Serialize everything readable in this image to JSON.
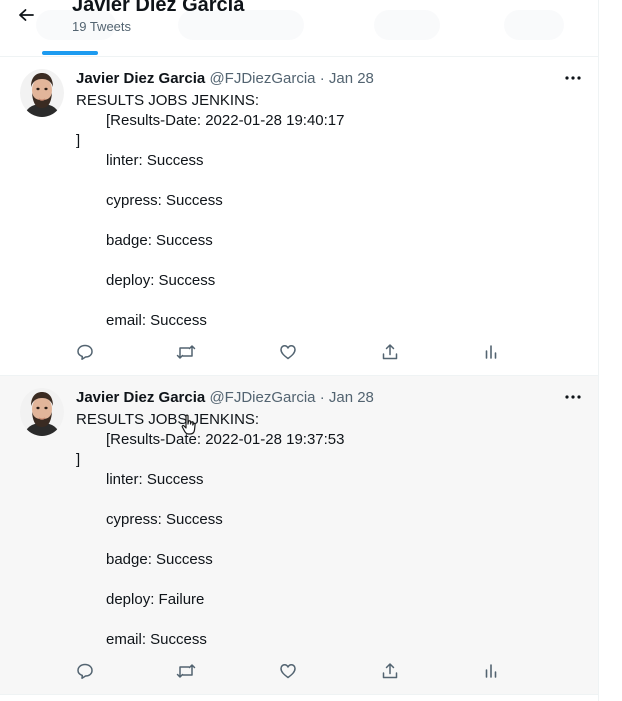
{
  "header": {
    "profile_name": "Javier Diez Garcia",
    "tweet_count": "19 Tweets"
  },
  "colors": {
    "accent": "#1d9bf0",
    "secondary_text": "#536471",
    "icon_gray": "#536471"
  },
  "icons": {
    "back": "arrow-left-icon",
    "more": "more-dots-icon",
    "reply": "reply-icon",
    "retweet": "retweet-icon",
    "like": "heart-icon",
    "share": "share-icon",
    "analytics": "analytics-icon"
  },
  "tweets": [
    {
      "author": "Javier Diez Garcia",
      "handle": "@FJDiezGarcia",
      "dot": "·",
      "date": "Jan 28",
      "lines": [
        "RESULTS JOBS JENKINS:",
        "[Results-Date: 2022-01-28 19:40:17",
        "]",
        "linter: Success",
        "cypress: Success",
        "badge: Success",
        "deploy: Success",
        "email: Success"
      ]
    },
    {
      "author": "Javier Diez Garcia",
      "handle": "@FJDiezGarcia",
      "dot": "·",
      "date": "Jan 28",
      "lines": [
        "RESULTS JOBS JENKINS:",
        "[Results-Date: 2022-01-28 19:37:53",
        "]",
        "linter: Success",
        "cypress: Success",
        "badge: Success",
        "deploy: Failure",
        "email: Success"
      ]
    }
  ]
}
